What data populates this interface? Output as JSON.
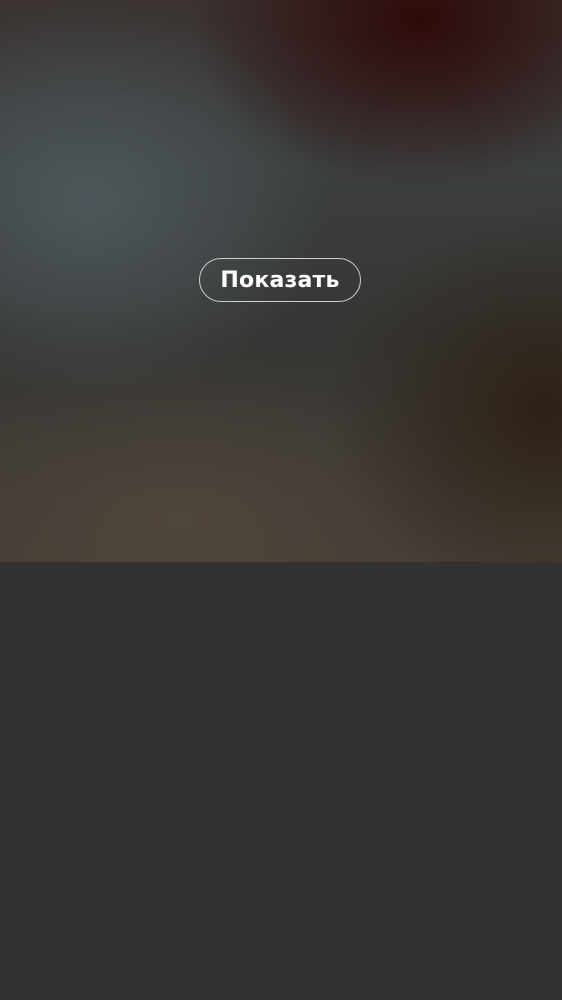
{
  "media": {
    "state": "hidden",
    "reveal_label": "Показать"
  },
  "colors": {
    "background": "#323232",
    "button_text": "#ffffff",
    "button_border": "#bfbfbf"
  }
}
